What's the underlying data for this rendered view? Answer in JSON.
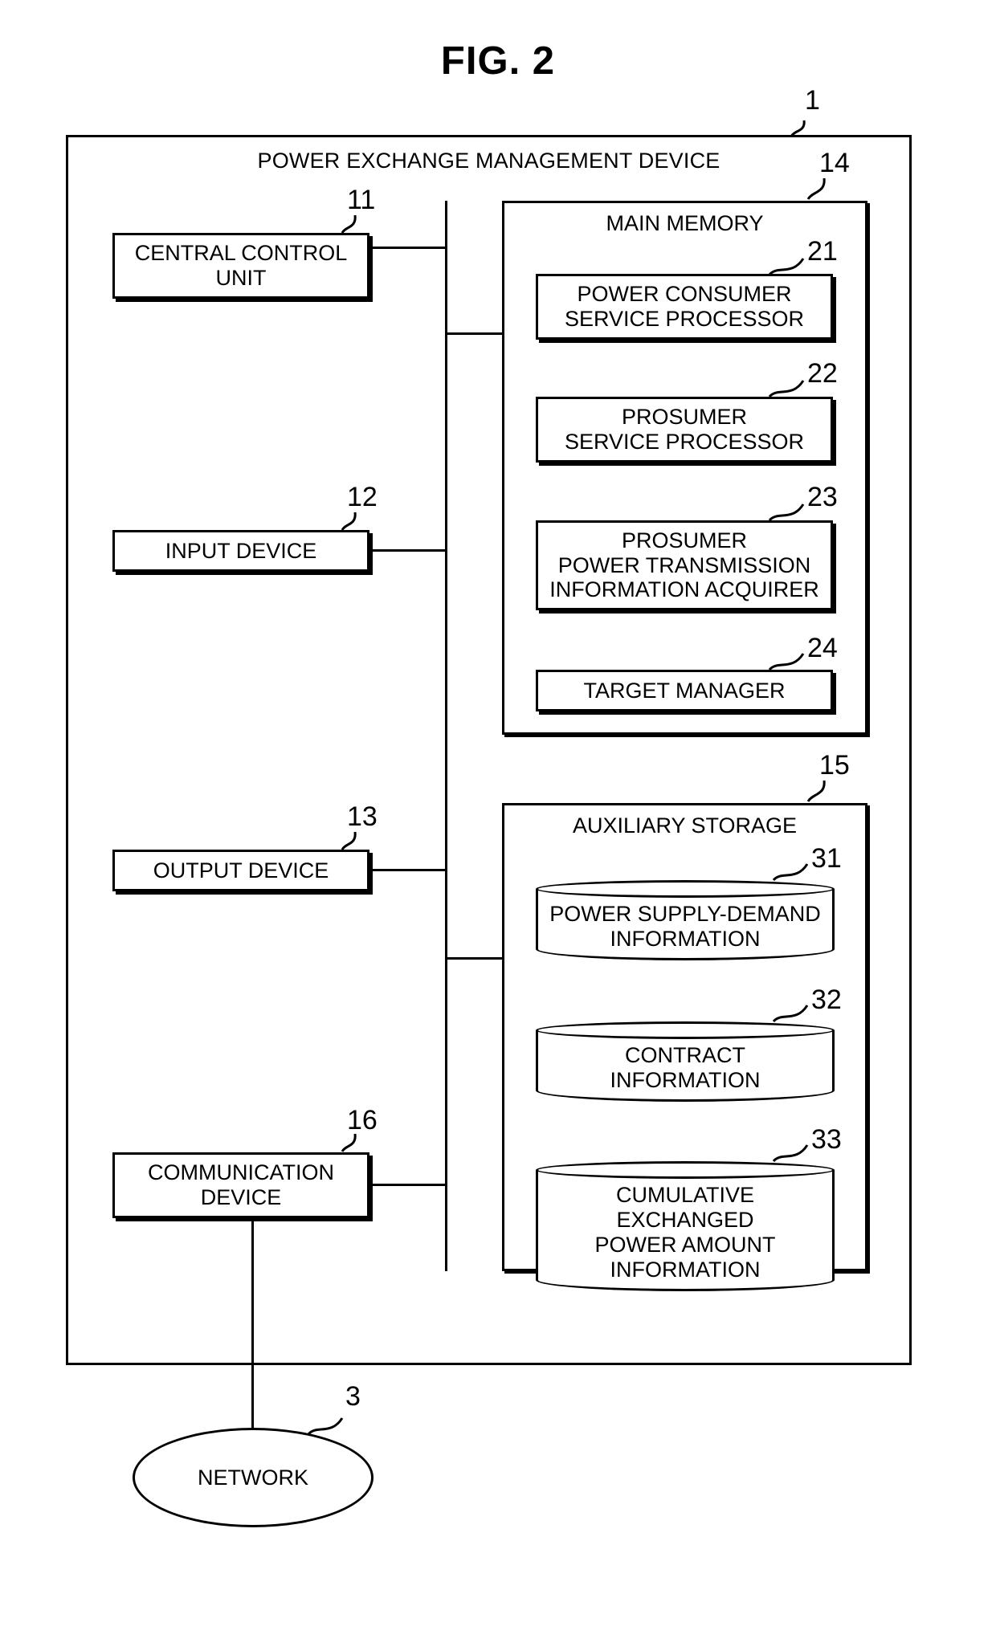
{
  "figure": {
    "title": "FIG. 2"
  },
  "frame": {
    "title": "POWER EXCHANGE MANAGEMENT DEVICE",
    "ref": "1"
  },
  "network": {
    "label": "NETWORK",
    "ref": "3"
  },
  "left_devices": [
    {
      "label": "CENTRAL CONTROL\nUNIT",
      "ref": "11"
    },
    {
      "label": "INPUT DEVICE",
      "ref": "12"
    },
    {
      "label": "OUTPUT DEVICE",
      "ref": "13"
    },
    {
      "label": "COMMUNICATION\nDEVICE",
      "ref": "16"
    }
  ],
  "main_memory": {
    "title": "MAIN MEMORY",
    "ref": "14",
    "modules": [
      {
        "label": "POWER CONSUMER\nSERVICE PROCESSOR",
        "ref": "21"
      },
      {
        "label": "PROSUMER\nSERVICE PROCESSOR",
        "ref": "22"
      },
      {
        "label": "PROSUMER\nPOWER TRANSMISSION\nINFORMATION ACQUIRER",
        "ref": "23"
      },
      {
        "label": "TARGET MANAGER",
        "ref": "24"
      }
    ]
  },
  "auxiliary_storage": {
    "title": "AUXILIARY STORAGE",
    "ref": "15",
    "stores": [
      {
        "label": "POWER SUPPLY-DEMAND\nINFORMATION",
        "ref": "31"
      },
      {
        "label": "CONTRACT\nINFORMATION",
        "ref": "32"
      },
      {
        "label": "CUMULATIVE\nEXCHANGED\nPOWER AMOUNT\nINFORMATION",
        "ref": "33"
      }
    ]
  },
  "colors": {
    "stroke": "#000000",
    "background": "#ffffff"
  }
}
